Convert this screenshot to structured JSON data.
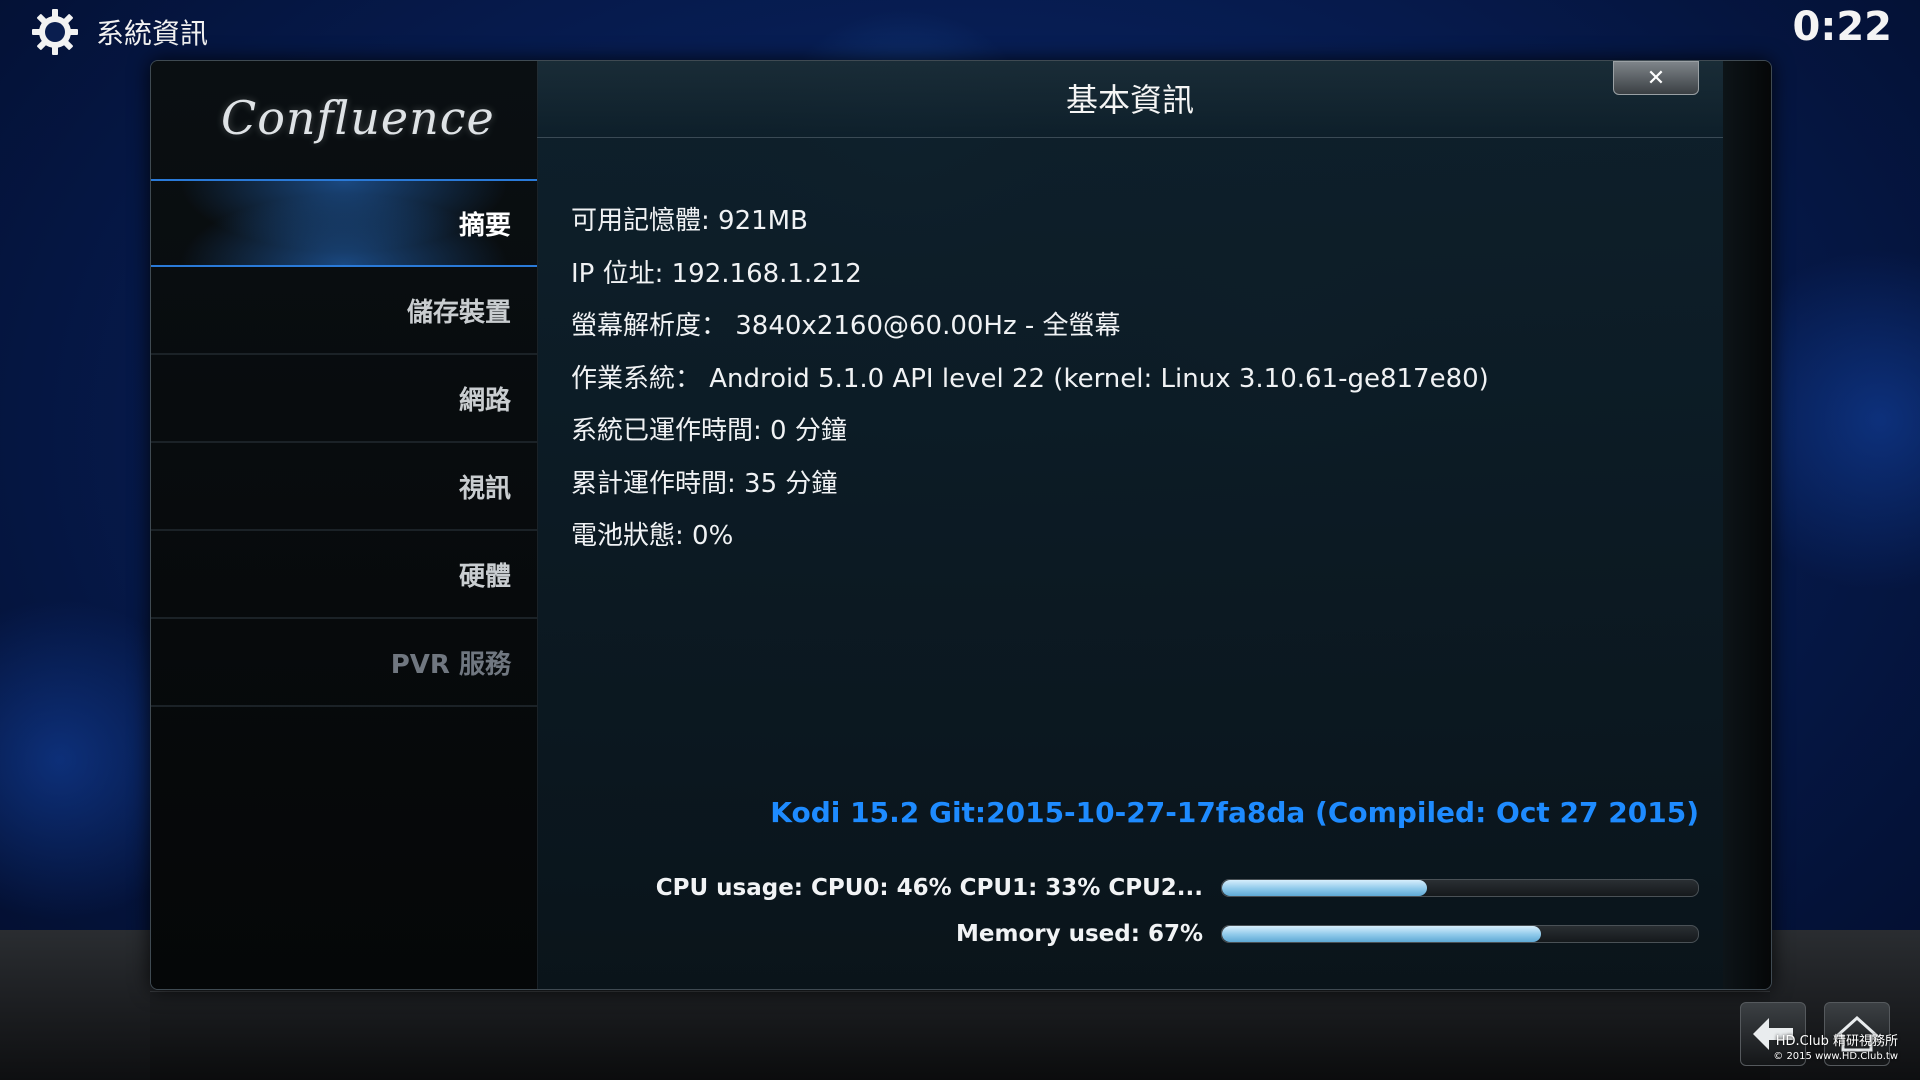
{
  "header": {
    "title": "系統資訊",
    "icon": "gear-icon",
    "clock": "0:22"
  },
  "dialog": {
    "title": "基本資訊",
    "close_label": "✕"
  },
  "sidebar": {
    "logo": "Confluence",
    "items": [
      {
        "label": "摘要",
        "state": "active"
      },
      {
        "label": "儲存裝置",
        "state": "normal"
      },
      {
        "label": "網路",
        "state": "normal"
      },
      {
        "label": "視訊",
        "state": "normal"
      },
      {
        "label": "硬體",
        "state": "normal"
      },
      {
        "label": "PVR 服務",
        "state": "disabled"
      }
    ]
  },
  "info": {
    "lines": [
      "可用記憶體: 921MB",
      "IP 位址: 192.168.1.212",
      "螢幕解析度： 3840x2160@60.00Hz - 全螢幕",
      "作業系統： Android 5.1.0 API level 22 (kernel: Linux 3.10.61-ge817e80)",
      "系統已運作時間: 0 分鐘",
      "累計運作時間: 35 分鐘",
      "電池狀態: 0%"
    ]
  },
  "version": "Kodi 15.2 Git:2015-10-27-17fa8da (Compiled: Oct 27 2015)",
  "stats": {
    "cpu_label": "CPU usage: CPU0:  46% CPU1:  33% CPU2...",
    "cpu_fraction": 0.43,
    "memory_label": "Memory used: 67%",
    "memory_fraction": 0.67
  },
  "footer": {
    "back_icon": "back-arrow-icon",
    "home_icon": "home-icon",
    "watermark_line1": "HD.Club 精研視務所",
    "watermark_line2": "© 2015  www.HD.Club.tw"
  },
  "colors": {
    "accent": "#1e8bff",
    "bar_fill": "#8ec9ea"
  }
}
